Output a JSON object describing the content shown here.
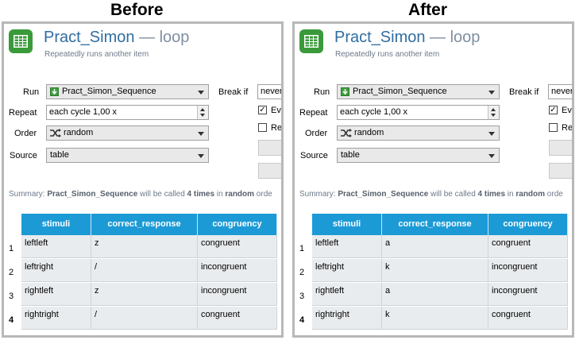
{
  "headings": {
    "before": "Before",
    "after": "After"
  },
  "panels": {
    "before": {
      "title": "Pract_Simon",
      "title_sep": " — loop",
      "subtitle": "Repeatedly runs another item",
      "run_label": "Run",
      "run_value": "Pract_Simon_Sequence",
      "repeat_label": "Repeat",
      "repeat_value": "each cycle 1,00 x",
      "order_label": "Order",
      "order_value": "random",
      "source_label": "Source",
      "source_value": "table",
      "breakif_label": "Break if",
      "breakif_value": "never",
      "check1_label": "Eva",
      "check1_checked": "✓",
      "check2_label": "Re",
      "summary_pre": "Summary: ",
      "summary_item": "Pract_Simon_Sequence",
      "summary_mid": " will be called ",
      "summary_count": "4 times",
      "summary_in": " in ",
      "summary_order": "random",
      "summary_post": " orde",
      "columns": [
        "stimuli",
        "correct_response",
        "congruency"
      ],
      "rows": [
        {
          "num": "1",
          "stimuli": "leftleft",
          "correct_response": "z",
          "congruency": "congruent"
        },
        {
          "num": "2",
          "stimuli": "leftright",
          "correct_response": "/",
          "congruency": "incongruent"
        },
        {
          "num": "3",
          "stimuli": "rightleft",
          "correct_response": "z",
          "congruency": "incongruent"
        },
        {
          "num": "4",
          "stimuli": "rightright",
          "correct_response": "/",
          "congruency": "congruent"
        }
      ]
    },
    "after": {
      "title": "Pract_Simon",
      "title_sep": " — loop",
      "subtitle": "Repeatedly runs another item",
      "run_label": "Run",
      "run_value": "Pract_Simon_Sequence",
      "repeat_label": "Repeat",
      "repeat_value": "each cycle 1,00 x",
      "order_label": "Order",
      "order_value": "random",
      "source_label": "Source",
      "source_value": "table",
      "breakif_label": "Break if",
      "breakif_value": "never",
      "check1_label": "Eva",
      "check1_checked": "✓",
      "check2_label": "Re",
      "summary_pre": "Summary: ",
      "summary_item": "Pract_Simon_Sequence",
      "summary_mid": " will be called ",
      "summary_count": "4 times",
      "summary_in": " in ",
      "summary_order": "random",
      "summary_post": " orde",
      "columns": [
        "stimuli",
        "correct_response",
        "congruency"
      ],
      "rows": [
        {
          "num": "1",
          "stimuli": "leftleft",
          "correct_response": "a",
          "congruency": "congruent"
        },
        {
          "num": "2",
          "stimuli": "leftright",
          "correct_response": "k",
          "congruency": "incongruent"
        },
        {
          "num": "3",
          "stimuli": "rightleft",
          "correct_response": "a",
          "congruency": "incongruent"
        },
        {
          "num": "4",
          "stimuli": "rightright",
          "correct_response": "k",
          "congruency": "congruent"
        }
      ]
    }
  },
  "icons": {
    "app": "table-grid-icon",
    "run": "green-arrow-icon",
    "order": "shuffle-icon"
  },
  "colors": {
    "header_blue": "#1c9ad6",
    "title_blue": "#2f6da0",
    "app_icon_green": "#3a9a3a"
  }
}
